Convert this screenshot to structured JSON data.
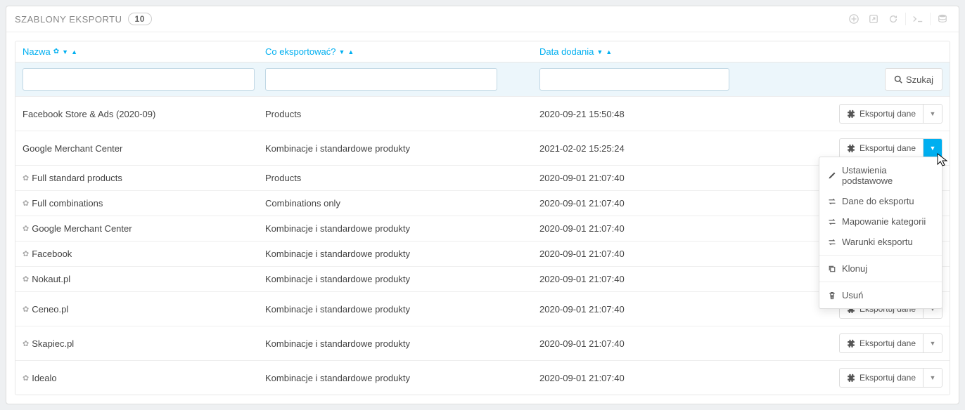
{
  "header": {
    "title": "SZABLONY EKSPORTU",
    "count": "10"
  },
  "columns": {
    "name": "Nazwa",
    "what": "Co eksportować?",
    "date": "Data dodania"
  },
  "search_button": "Szukaj",
  "export_button": "Eksportuj dane",
  "dropdown": {
    "basic": "Ustawienia podstawowe",
    "data": "Dane do eksportu",
    "mapping": "Mapowanie kategorii",
    "conditions": "Warunki eksportu",
    "clone": "Klonuj",
    "delete": "Usuń"
  },
  "rows": [
    {
      "name": "Facebook Store & Ads (2020-09)",
      "what": "Products",
      "date": "2020-09-21 15:50:48",
      "system": false,
      "dd_open": false,
      "show_btn": true
    },
    {
      "name": "Google Merchant Center",
      "what": "Kombinacje i standardowe produkty",
      "date": "2021-02-02 15:25:24",
      "system": false,
      "dd_open": true,
      "show_btn": true
    },
    {
      "name": "Full standard products",
      "what": "Products",
      "date": "2020-09-01 21:07:40",
      "system": true,
      "dd_open": false,
      "show_btn": false
    },
    {
      "name": "Full combinations",
      "what": "Combinations only",
      "date": "2020-09-01 21:07:40",
      "system": true,
      "dd_open": false,
      "show_btn": false
    },
    {
      "name": "Google Merchant Center",
      "what": "Kombinacje i standardowe produkty",
      "date": "2020-09-01 21:07:40",
      "system": true,
      "dd_open": false,
      "show_btn": false
    },
    {
      "name": "Facebook",
      "what": "Kombinacje i standardowe produkty",
      "date": "2020-09-01 21:07:40",
      "system": true,
      "dd_open": false,
      "show_btn": false
    },
    {
      "name": "Nokaut.pl",
      "what": "Kombinacje i standardowe produkty",
      "date": "2020-09-01 21:07:40",
      "system": true,
      "dd_open": false,
      "show_btn": false
    },
    {
      "name": "Ceneo.pl",
      "what": "Kombinacje i standardowe produkty",
      "date": "2020-09-01 21:07:40",
      "system": true,
      "dd_open": false,
      "show_btn": true
    },
    {
      "name": "Skapiec.pl",
      "what": "Kombinacje i standardowe produkty",
      "date": "2020-09-01 21:07:40",
      "system": true,
      "dd_open": false,
      "show_btn": true
    },
    {
      "name": "Idealo",
      "what": "Kombinacje i standardowe produkty",
      "date": "2020-09-01 21:07:40",
      "system": true,
      "dd_open": false,
      "show_btn": true
    }
  ]
}
